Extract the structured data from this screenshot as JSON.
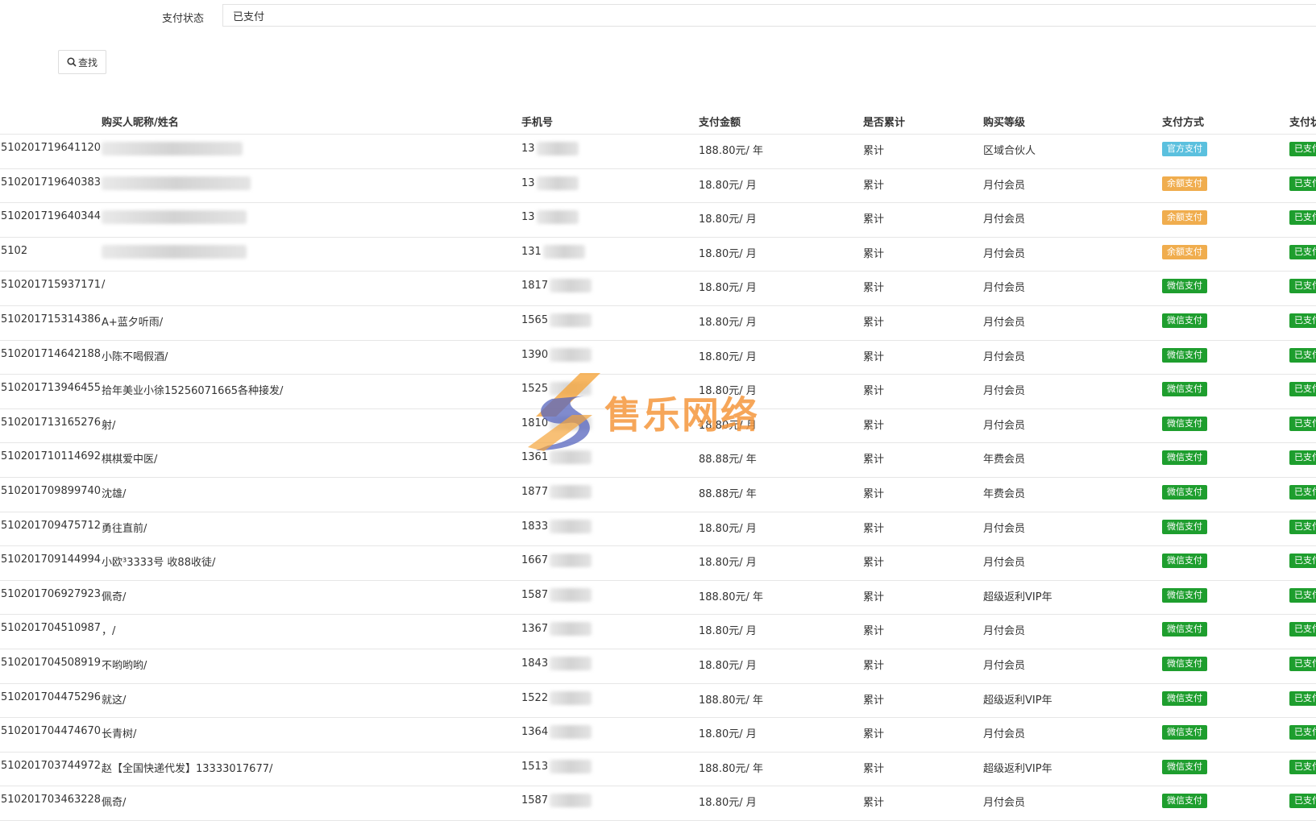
{
  "filter": {
    "label": "支付状态",
    "value": "已支付"
  },
  "search_button": {
    "label": "查找"
  },
  "columns": [
    "购买人昵称/姓名",
    "手机号",
    "支付金额",
    "是否累计",
    "购买等级",
    "支付方式",
    "支付状态"
  ],
  "colors": {
    "official_pay": "#5bc0de",
    "balance_pay": "#f0ad4e",
    "wechat_pay": "#1e9e2e",
    "status_paid": "#1e9e2e",
    "border": "#e6e6e6"
  },
  "rows": [
    {
      "order": "510201719641120",
      "name": "",
      "name_masked": true,
      "phone": "13",
      "amount": "188.80元/ 年",
      "accumulate": "累计",
      "level": "区域合伙人",
      "method": "官方支付",
      "method_type": "official_pay",
      "status": "已支付"
    },
    {
      "order": "510201719640383",
      "name": "",
      "name_masked": true,
      "phone": "13",
      "amount": "18.80元/ 月",
      "accumulate": "累计",
      "level": "月付会员",
      "method": "余额支付",
      "method_type": "balance_pay",
      "status": "已支付"
    },
    {
      "order": "510201719640344",
      "name": "",
      "name_masked": true,
      "phone": "13",
      "amount": "18.80元/ 月",
      "accumulate": "累计",
      "level": "月付会员",
      "method": "余额支付",
      "method_type": "balance_pay",
      "status": "已支付"
    },
    {
      "order": "5102",
      "name": "",
      "name_masked": true,
      "phone": "131",
      "amount": "18.80元/ 月",
      "accumulate": "累计",
      "level": "月付会员",
      "method": "余额支付",
      "method_type": "balance_pay",
      "status": "已支付"
    },
    {
      "order": "510201715937171",
      "name": "/",
      "phone": "1817",
      "amount": "18.80元/ 月",
      "accumulate": "累计",
      "level": "月付会员",
      "method": "微信支付",
      "method_type": "wechat_pay",
      "status": "已支付"
    },
    {
      "order": "510201715314386",
      "name": "A+蓝夕听雨/",
      "phone": "1565",
      "amount": "18.80元/ 月",
      "accumulate": "累计",
      "level": "月付会员",
      "method": "微信支付",
      "method_type": "wechat_pay",
      "status": "已支付"
    },
    {
      "order": "510201714642188",
      "name": "小陈不喝假酒/",
      "phone": "1390",
      "amount": "18.80元/ 月",
      "accumulate": "累计",
      "level": "月付会员",
      "method": "微信支付",
      "method_type": "wechat_pay",
      "status": "已支付"
    },
    {
      "order": "510201713946455",
      "name": "拾年美业小徐15256071665各种接发/",
      "phone": "1525",
      "amount": "18.80元/ 月",
      "accumulate": "累计",
      "level": "月付会员",
      "method": "微信支付",
      "method_type": "wechat_pay",
      "status": "已支付"
    },
    {
      "order": "510201713165276",
      "name": "射/",
      "phone": "1810",
      "amount": "18.80元/ 月",
      "accumulate": "累计",
      "level": "月付会员",
      "method": "微信支付",
      "method_type": "wechat_pay",
      "status": "已支付"
    },
    {
      "order": "510201710114692",
      "name": "棋棋爱中医/",
      "phone": "1361",
      "amount": "88.88元/ 年",
      "accumulate": "累计",
      "level": "年费会员",
      "method": "微信支付",
      "method_type": "wechat_pay",
      "status": "已支付"
    },
    {
      "order": "510201709899740",
      "name": "沈雄/",
      "phone": "1877",
      "amount": "88.88元/ 年",
      "accumulate": "累计",
      "level": "年费会员",
      "method": "微信支付",
      "method_type": "wechat_pay",
      "status": "已支付"
    },
    {
      "order": "510201709475712",
      "name": "勇往直前/",
      "phone": "1833",
      "amount": "18.80元/ 月",
      "accumulate": "累计",
      "level": "月付会员",
      "method": "微信支付",
      "method_type": "wechat_pay",
      "status": "已支付"
    },
    {
      "order": "510201709144994",
      "name": "小欧³3333号 收88收徒/",
      "phone": "1667",
      "amount": "18.80元/ 月",
      "accumulate": "累计",
      "level": "月付会员",
      "method": "微信支付",
      "method_type": "wechat_pay",
      "status": "已支付"
    },
    {
      "order": "510201706927923",
      "name": "佩奇/",
      "phone": "1587",
      "amount": "188.80元/ 年",
      "accumulate": "累计",
      "level": "超级返利VIP年",
      "method": "微信支付",
      "method_type": "wechat_pay",
      "status": "已支付"
    },
    {
      "order": "510201704510987",
      "name": "，/",
      "phone": "1367",
      "amount": "18.80元/ 月",
      "accumulate": "累计",
      "level": "月付会员",
      "method": "微信支付",
      "method_type": "wechat_pay",
      "status": "已支付"
    },
    {
      "order": "510201704508919",
      "name": "不哟哟哟/",
      "phone": "1843",
      "amount": "18.80元/ 月",
      "accumulate": "累计",
      "level": "月付会员",
      "method": "微信支付",
      "method_type": "wechat_pay",
      "status": "已支付"
    },
    {
      "order": "510201704475296",
      "name": "就这/",
      "phone": "1522",
      "amount": "188.80元/ 年",
      "accumulate": "累计",
      "level": "超级返利VIP年",
      "method": "微信支付",
      "method_type": "wechat_pay",
      "status": "已支付"
    },
    {
      "order": "510201704474670",
      "name": "长青树/",
      "phone": "1364",
      "amount": "18.80元/ 月",
      "accumulate": "累计",
      "level": "月付会员",
      "method": "微信支付",
      "method_type": "wechat_pay",
      "status": "已支付"
    },
    {
      "order": "510201703744972",
      "name": "赵【全国快递代发】13333017677/",
      "phone": "1513",
      "amount": "188.80元/ 年",
      "accumulate": "累计",
      "level": "超级返利VIP年",
      "method": "微信支付",
      "method_type": "wechat_pay",
      "status": "已支付"
    },
    {
      "order": "510201703463228",
      "name": "佩奇/",
      "phone": "1587",
      "amount": "18.80元/ 月",
      "accumulate": "累计",
      "level": "月付会员",
      "method": "微信支付",
      "method_type": "wechat_pay",
      "status": "已支付"
    }
  ],
  "watermark": {
    "text": "售乐网络"
  }
}
